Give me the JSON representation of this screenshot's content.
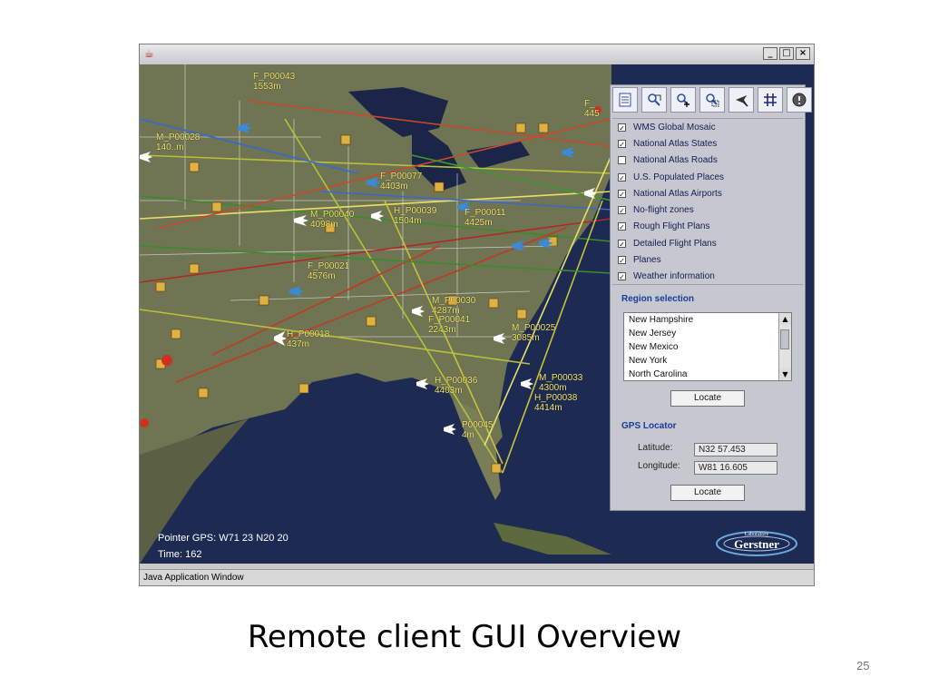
{
  "slide": {
    "title": "Remote client GUI Overview",
    "page_number": "25"
  },
  "window": {
    "title_icon": "java-cup-icon",
    "controls": [
      "_",
      "□",
      "×"
    ],
    "status_text": "Java Application Window"
  },
  "map": {
    "pointer_gps": "Pointer GPS: W71 23  N20 20",
    "time_label": "Time: 162",
    "logo_label": "Gerstner",
    "logo_sublabel": "Laboratory",
    "flight_labels": [
      {
        "id": "F_P00043",
        "alt": "1553m"
      },
      {
        "id": "M_P00028",
        "alt": "140..m"
      },
      {
        "id": "F_P00077",
        "alt": "4403m"
      },
      {
        "id": "M_P00040",
        "alt": "4098m"
      },
      {
        "id": "H_P00039",
        "alt": "1504m"
      },
      {
        "id": "F_P00011",
        "alt": "4425m"
      },
      {
        "id": "F_P00021",
        "alt": "4576m"
      },
      {
        "id": "M_P00030",
        "alt": "4287m"
      },
      {
        "id": "F_P00041",
        "alt": "2243m"
      },
      {
        "id": "M_P00025",
        "alt": "3085m"
      },
      {
        "id": "H_P00018",
        "alt": "437m"
      },
      {
        "id": "H_P00036",
        "alt": "4403m"
      },
      {
        "id": "M_P00033",
        "alt": "4300m"
      },
      {
        "id": "H_P00038",
        "alt": "4414m"
      },
      {
        "id": "P00045",
        "alt": "4m"
      },
      {
        "id": "F_",
        "alt": "445"
      }
    ]
  },
  "toolbar": {
    "icons": [
      "layers-icon",
      "pan-zoom-icon",
      "zoom-in-icon",
      "zoom-region-icon",
      "select-plane-icon",
      "grid-icon",
      "info-icon"
    ]
  },
  "layers": [
    {
      "label": "WMS Global Mosaic",
      "checked": true
    },
    {
      "label": "National Atlas States",
      "checked": true
    },
    {
      "label": "National Atlas Roads",
      "checked": false
    },
    {
      "label": "U.S. Populated Places",
      "checked": true
    },
    {
      "label": "National Atlas Airports",
      "checked": true
    },
    {
      "label": "No-flight zones",
      "checked": true
    },
    {
      "label": "Rough Flight Plans",
      "checked": true
    },
    {
      "label": "Detailed Flight Plans",
      "checked": true
    },
    {
      "label": "Planes",
      "checked": true
    },
    {
      "label": "Weather information",
      "checked": true
    }
  ],
  "region": {
    "title": "Region selection",
    "items": [
      "New Hampshire",
      "New Jersey",
      "New Mexico",
      "New York",
      "North Carolina"
    ],
    "locate_label": "Locate"
  },
  "gps": {
    "title": "GPS Locator",
    "latitude_label": "Latitude:",
    "latitude_value": "N32 57.453",
    "longitude_label": "Longitude:",
    "longitude_value": "W81 16.605",
    "locate_label": "Locate"
  },
  "colors": {
    "panel_bg": "#c6c8cf",
    "section_title": "#1b3a9a",
    "flight_label": "#f5e970",
    "ocean": "#1d2b52",
    "land": "#6f7452"
  }
}
